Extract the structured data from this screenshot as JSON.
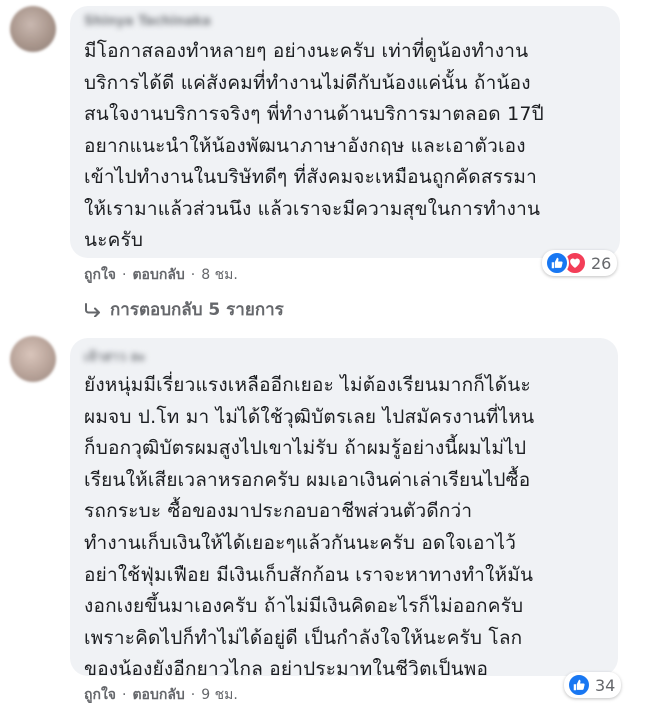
{
  "comments": [
    {
      "author": "Shinya Tachinaka",
      "text": "มีโอกาสลองทำหลายๆ อย่างนะครับ เท่าที่ดูน้องทำงาน\nบริการได้ดี แค่สังคมที่ทำงานไม่ดีกับน้องแค่นั้น ถ้าน้อง\nสนใจงานบริการจริงๆ พี่ทำงานด้านบริการมาตลอด 17ปี\nอยากแนะนำให้น้องพัฒนาภาษาอังกฤษ และเอาตัวเอง\nเข้าไปทำงานในบริษัทดีๆ ที่สังคมจะเหมือนถูกคัดสรรมา\nให้เรามาแล้วส่วนนึง แล้วเราจะมีความสุขในการทำงาน\nนะครับ",
      "like_label": "ถูกใจ",
      "reply_label": "ตอบกลับ",
      "separator": "·",
      "time": "8 ชม.",
      "reaction_count": "26",
      "reaction_icons": [
        "like-icon",
        "love-icon"
      ]
    },
    {
      "author": "เจ้าสาว ละ",
      "text": "ยังหนุ่มมีเรี่ยวแรงเหลืออีกเยอะ ไม่ต้องเรียนมากก็ได้นะ\nผมจบ ป.โท มา ไม่ได้ใช้วุฒิบัตรเลย ไปสมัครงานที่ไหน\nก็บอกวุฒิบัตรผมสูงไปเขาไม่รับ ถ้าผมรู้อย่างนี้ผมไม่ไป\nเรียนให้เสียเวลาหรอกครับ ผมเอาเงินค่าเล่าเรียนไปซื้อ\nรถกระบะ ซื้อของมาประกอบอาชีพส่วนตัวดีกว่า\nทำงานเก็บเงินให้ได้เยอะๆแล้วกันนะครับ อดใจเอาไว้\nอย่าใช้ฟุ่มเฟือย มีเงินเก็บสักก้อน เราจะหาทางทำให้มัน\nงอกเงยขึ้นมาเองครับ ถ้าไม่มีเงินคิดอะไรก็ไม่ออกครับ\nเพราะคิดไปก็ทำไม่ได้อยู่ดี เป็นกำลังใจให้นะครับ โลก\nของน้องยังอีกยาวไกล อย่าประมาทในชีวิตเป็นพอ",
      "like_label": "ถูกใจ",
      "reply_label": "ตอบกลับ",
      "separator": "·",
      "time": "9 ชม.",
      "reaction_count": "34",
      "reaction_icons": [
        "like-icon"
      ]
    }
  ],
  "replies_link": "การตอบกลับ 5 รายการ",
  "colors": {
    "bubble": "#f0f2f5",
    "text": "#1c1e21",
    "secondary": "#65676b",
    "like": "#1877f2",
    "love": "#f33e58"
  }
}
